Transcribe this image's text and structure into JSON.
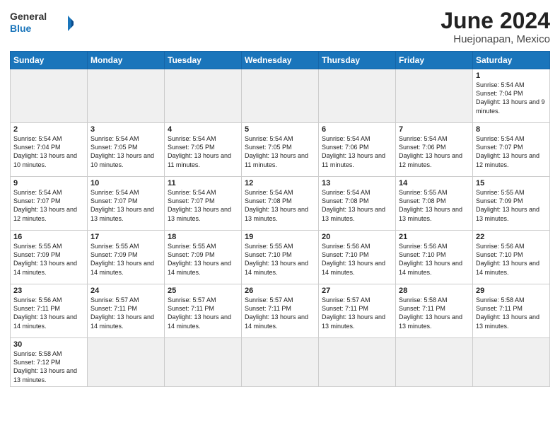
{
  "header": {
    "logo_general": "General",
    "logo_blue": "Blue",
    "month": "June 2024",
    "location": "Huejonapan, Mexico"
  },
  "weekdays": [
    "Sunday",
    "Monday",
    "Tuesday",
    "Wednesday",
    "Thursday",
    "Friday",
    "Saturday"
  ],
  "weeks": [
    [
      {
        "day": "",
        "empty": true
      },
      {
        "day": "",
        "empty": true
      },
      {
        "day": "",
        "empty": true
      },
      {
        "day": "",
        "empty": true
      },
      {
        "day": "",
        "empty": true
      },
      {
        "day": "",
        "empty": true
      },
      {
        "day": "1",
        "sunrise": "Sunrise: 5:54 AM",
        "sunset": "Sunset: 7:04 PM",
        "daylight": "Daylight: 13 hours and 9 minutes."
      }
    ],
    [
      {
        "day": "2",
        "sunrise": "Sunrise: 5:54 AM",
        "sunset": "Sunset: 7:04 PM",
        "daylight": "Daylight: 13 hours and 10 minutes."
      },
      {
        "day": "3",
        "sunrise": "Sunrise: 5:54 AM",
        "sunset": "Sunset: 7:05 PM",
        "daylight": "Daylight: 13 hours and 10 minutes."
      },
      {
        "day": "4",
        "sunrise": "Sunrise: 5:54 AM",
        "sunset": "Sunset: 7:05 PM",
        "daylight": "Daylight: 13 hours and 11 minutes."
      },
      {
        "day": "5",
        "sunrise": "Sunrise: 5:54 AM",
        "sunset": "Sunset: 7:05 PM",
        "daylight": "Daylight: 13 hours and 11 minutes."
      },
      {
        "day": "6",
        "sunrise": "Sunrise: 5:54 AM",
        "sunset": "Sunset: 7:06 PM",
        "daylight": "Daylight: 13 hours and 11 minutes."
      },
      {
        "day": "7",
        "sunrise": "Sunrise: 5:54 AM",
        "sunset": "Sunset: 7:06 PM",
        "daylight": "Daylight: 13 hours and 12 minutes."
      },
      {
        "day": "8",
        "sunrise": "Sunrise: 5:54 AM",
        "sunset": "Sunset: 7:07 PM",
        "daylight": "Daylight: 13 hours and 12 minutes."
      }
    ],
    [
      {
        "day": "9",
        "sunrise": "Sunrise: 5:54 AM",
        "sunset": "Sunset: 7:07 PM",
        "daylight": "Daylight: 13 hours and 12 minutes."
      },
      {
        "day": "10",
        "sunrise": "Sunrise: 5:54 AM",
        "sunset": "Sunset: 7:07 PM",
        "daylight": "Daylight: 13 hours and 13 minutes."
      },
      {
        "day": "11",
        "sunrise": "Sunrise: 5:54 AM",
        "sunset": "Sunset: 7:07 PM",
        "daylight": "Daylight: 13 hours and 13 minutes."
      },
      {
        "day": "12",
        "sunrise": "Sunrise: 5:54 AM",
        "sunset": "Sunset: 7:08 PM",
        "daylight": "Daylight: 13 hours and 13 minutes."
      },
      {
        "day": "13",
        "sunrise": "Sunrise: 5:54 AM",
        "sunset": "Sunset: 7:08 PM",
        "daylight": "Daylight: 13 hours and 13 minutes."
      },
      {
        "day": "14",
        "sunrise": "Sunrise: 5:55 AM",
        "sunset": "Sunset: 7:08 PM",
        "daylight": "Daylight: 13 hours and 13 minutes."
      },
      {
        "day": "15",
        "sunrise": "Sunrise: 5:55 AM",
        "sunset": "Sunset: 7:09 PM",
        "daylight": "Daylight: 13 hours and 13 minutes."
      }
    ],
    [
      {
        "day": "16",
        "sunrise": "Sunrise: 5:55 AM",
        "sunset": "Sunset: 7:09 PM",
        "daylight": "Daylight: 13 hours and 14 minutes."
      },
      {
        "day": "17",
        "sunrise": "Sunrise: 5:55 AM",
        "sunset": "Sunset: 7:09 PM",
        "daylight": "Daylight: 13 hours and 14 minutes."
      },
      {
        "day": "18",
        "sunrise": "Sunrise: 5:55 AM",
        "sunset": "Sunset: 7:09 PM",
        "daylight": "Daylight: 13 hours and 14 minutes."
      },
      {
        "day": "19",
        "sunrise": "Sunrise: 5:55 AM",
        "sunset": "Sunset: 7:10 PM",
        "daylight": "Daylight: 13 hours and 14 minutes."
      },
      {
        "day": "20",
        "sunrise": "Sunrise: 5:56 AM",
        "sunset": "Sunset: 7:10 PM",
        "daylight": "Daylight: 13 hours and 14 minutes."
      },
      {
        "day": "21",
        "sunrise": "Sunrise: 5:56 AM",
        "sunset": "Sunset: 7:10 PM",
        "daylight": "Daylight: 13 hours and 14 minutes."
      },
      {
        "day": "22",
        "sunrise": "Sunrise: 5:56 AM",
        "sunset": "Sunset: 7:10 PM",
        "daylight": "Daylight: 13 hours and 14 minutes."
      }
    ],
    [
      {
        "day": "23",
        "sunrise": "Sunrise: 5:56 AM",
        "sunset": "Sunset: 7:11 PM",
        "daylight": "Daylight: 13 hours and 14 minutes."
      },
      {
        "day": "24",
        "sunrise": "Sunrise: 5:57 AM",
        "sunset": "Sunset: 7:11 PM",
        "daylight": "Daylight: 13 hours and 14 minutes."
      },
      {
        "day": "25",
        "sunrise": "Sunrise: 5:57 AM",
        "sunset": "Sunset: 7:11 PM",
        "daylight": "Daylight: 13 hours and 14 minutes."
      },
      {
        "day": "26",
        "sunrise": "Sunrise: 5:57 AM",
        "sunset": "Sunset: 7:11 PM",
        "daylight": "Daylight: 13 hours and 14 minutes."
      },
      {
        "day": "27",
        "sunrise": "Sunrise: 5:57 AM",
        "sunset": "Sunset: 7:11 PM",
        "daylight": "Daylight: 13 hours and 13 minutes."
      },
      {
        "day": "28",
        "sunrise": "Sunrise: 5:58 AM",
        "sunset": "Sunset: 7:11 PM",
        "daylight": "Daylight: 13 hours and 13 minutes."
      },
      {
        "day": "29",
        "sunrise": "Sunrise: 5:58 AM",
        "sunset": "Sunset: 7:11 PM",
        "daylight": "Daylight: 13 hours and 13 minutes."
      }
    ],
    [
      {
        "day": "30",
        "sunrise": "Sunrise: 5:58 AM",
        "sunset": "Sunset: 7:12 PM",
        "daylight": "Daylight: 13 hours and 13 minutes."
      },
      {
        "day": "",
        "empty": true
      },
      {
        "day": "",
        "empty": true
      },
      {
        "day": "",
        "empty": true
      },
      {
        "day": "",
        "empty": true
      },
      {
        "day": "",
        "empty": true
      },
      {
        "day": "",
        "empty": true
      }
    ]
  ]
}
